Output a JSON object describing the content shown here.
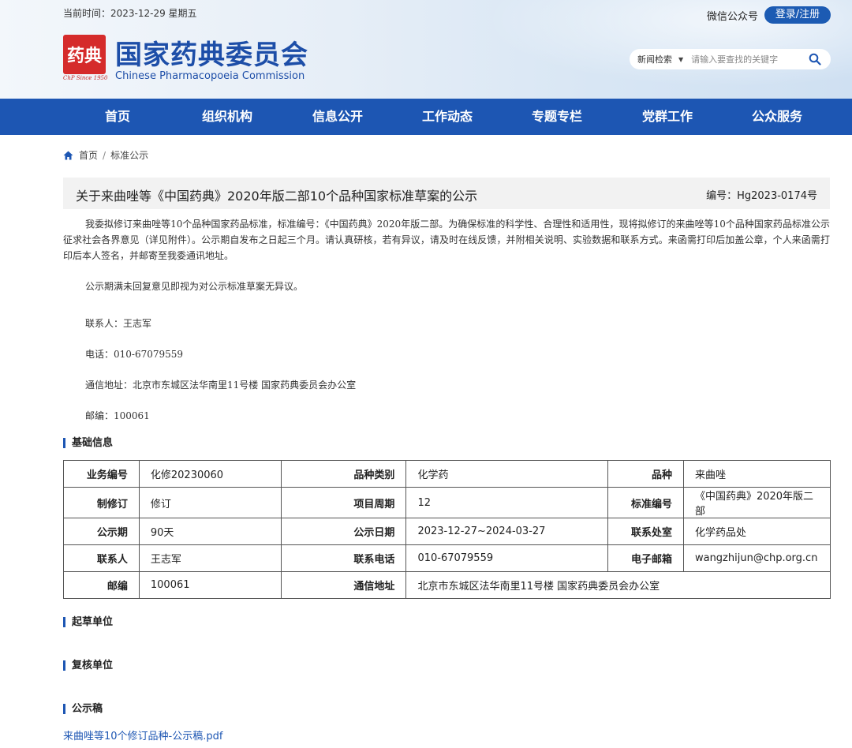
{
  "header": {
    "date_label": "当前时间：2023-12-29 星期五",
    "wechat_label": "微信公众号",
    "login_label": "登录/注册",
    "logo_seal_text": "药典",
    "logo_since": "ChP Since 1950",
    "logo_cn": "国家药典委员会",
    "logo_en": "Chinese Pharmacopoeia Commission",
    "search_category": "新闻检索",
    "search_placeholder": "请输入要查找的关键字"
  },
  "nav": {
    "items": [
      "首页",
      "组织机构",
      "信息公开",
      "工作动态",
      "专题专栏",
      "党群工作",
      "公众服务"
    ]
  },
  "breadcrumb": {
    "home": "首页",
    "separator": "/",
    "current": "标准公示"
  },
  "article": {
    "title": "关于来曲唑等《中国药典》2020年版二部10个品种国家标准草案的公示",
    "number": "编号：Hg2023-0174号",
    "para1": "我委拟修订来曲唑等10个品种国家药品标准，标准编号：《中国药典》2020年版二部。为确保标准的科学性、合理性和适用性，现将拟修订的来曲唑等10个品种国家药品标准公示征求社会各界意见（详见附件）。公示期自发布之日起三个月。请认真研核，若有异议，请及时在线反馈，并附相关说明、实验数据和联系方式。来函需打印后加盖公章，个人来函需打印后本人签名，并邮寄至我委通讯地址。",
    "para2": "公示期满未回复意见即视为对公示标准草案无异议。",
    "contact": "联系人：王志军",
    "phone": "电话：010-67079559",
    "address": "通信地址：北京市东城区法华南里11号楼 国家药典委员会办公室",
    "postcode": "邮编：100061"
  },
  "sections": {
    "basic_info": "基础信息",
    "drafting_unit": "起草单位",
    "review_unit": "复核单位",
    "draft": "公示稿"
  },
  "table": {
    "rows": [
      [
        "业务编号",
        "化修20230060",
        "品种类别",
        "化学药",
        "品种",
        "来曲唑"
      ],
      [
        "制修订",
        "修订",
        "项目周期",
        "12",
        "标准编号",
        "《中国药典》2020年版二部"
      ],
      [
        "公示期",
        "90天",
        "公示日期",
        "2023-12-27~2024-03-27",
        "联系处室",
        "化学药品处"
      ],
      [
        "联系人",
        "王志军",
        "联系电话",
        "010-67079559",
        "电子邮箱",
        "wangzhijun@chp.org.cn"
      ],
      [
        "邮编",
        "100061",
        "通信地址",
        "北京市东城区法华南里11号楼 国家药典委员会办公室"
      ]
    ]
  },
  "attachment": {
    "link_text": "来曲唑等10个修订品种-公示稿.pdf"
  },
  "colors": {
    "brand_blue": "#1d56b3",
    "seal_red": "#d52b2b"
  }
}
